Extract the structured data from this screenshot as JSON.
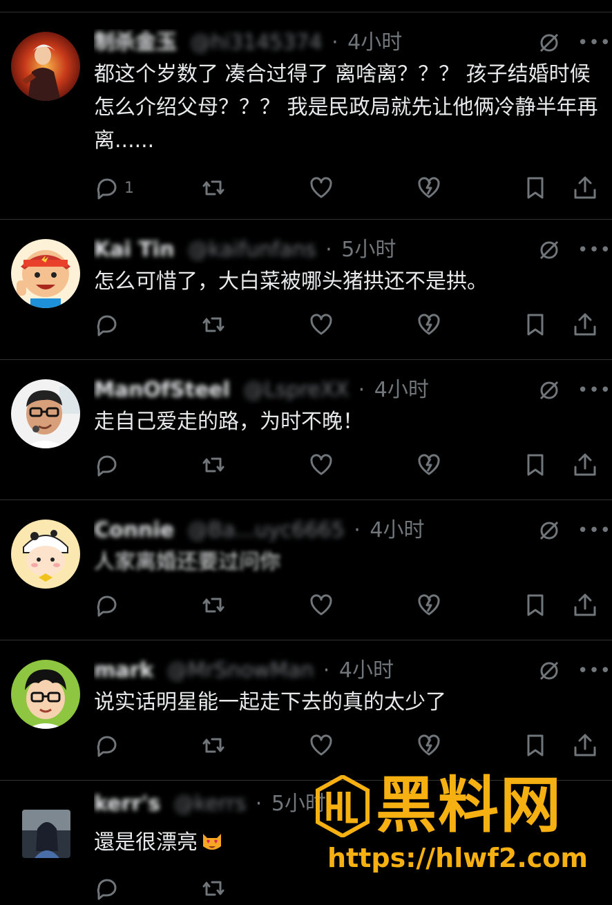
{
  "replies": [
    {
      "name": "制杀金玉",
      "handle": "@hi3145374",
      "time": "4小时",
      "text": "都这个岁数了 凑合过得了 离啥离？？？ 孩子结婚时候怎么介绍父母？？？ 我是民政局就先让他俩冷静半年再离......",
      "reply_count": "1",
      "text_blurred": false
    },
    {
      "name": "Kai Tin",
      "handle": "@kaifunfans",
      "time": "5小时",
      "text": "怎么可惜了，大白菜被哪头猪拱还不是拱。",
      "reply_count": "",
      "text_blurred": false
    },
    {
      "name": "ManOfSteel",
      "handle": "@LspreXX",
      "time": "4小时",
      "text": "走自己爱走的路，为时不晚！",
      "reply_count": "",
      "text_blurred": false
    },
    {
      "name": "Connie",
      "handle": "@Ba...uyc6665",
      "time": "4小时",
      "text": "人家离婚还要过问你",
      "reply_count": "",
      "text_blurred": true
    },
    {
      "name": "mark",
      "handle": "@MrSnowMan",
      "time": "4小时",
      "text": "说实话明星能一起走下去的真的太少了",
      "reply_count": "",
      "text_blurred": false
    },
    {
      "name": "kerr's",
      "handle": "@kerrs",
      "time": "5小时",
      "text": "還是很漂亮",
      "reply_count": "",
      "text_blurred": false
    }
  ],
  "icons": {
    "reply": "reply-icon",
    "repost": "repost-icon",
    "like": "like-icon",
    "dislike": "broken-heart-icon",
    "bookmark": "bookmark-icon",
    "share": "share-icon",
    "grok": "grok-icon",
    "more": "more-icon"
  },
  "watermark": {
    "title": "黑料网",
    "url": "https://hlwf2.com"
  },
  "colors": {
    "background": "#000000",
    "text": "#e7e9ea",
    "muted": "#71767b",
    "divider": "#2f3336",
    "watermark": "#f6b012"
  }
}
